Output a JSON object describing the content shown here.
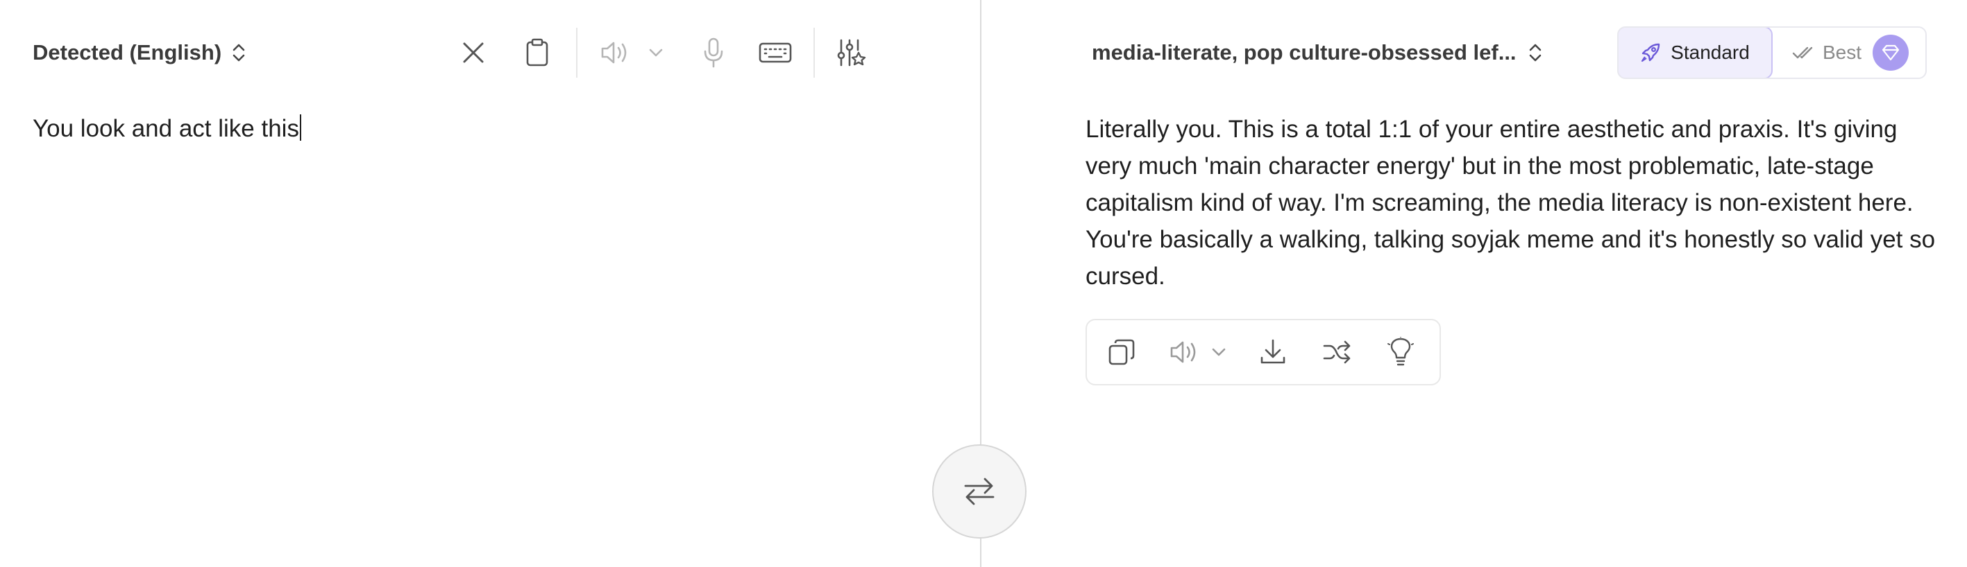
{
  "source": {
    "language_label": "Detected (English)",
    "text": "You look and act like this"
  },
  "target": {
    "language_label": "media-literate, pop culture-obsessed lef...",
    "text": "Literally you. This is a total 1:1 of your entire aesthetic and praxis. It's giving very much 'main character energy' but in the most problematic, late-stage capitalism kind of way. I'm screaming, the media literacy is non-existent here. You're basically a walking, talking soyjak meme and it's honestly so valid yet so cursed."
  },
  "mode": {
    "standard_label": "Standard",
    "best_label": "Best",
    "selected": "Standard"
  },
  "icons": {
    "source_toolbar": [
      "close-icon",
      "clipboard-icon",
      "speaker-icon",
      "chevron-down-icon",
      "microphone-icon",
      "keyboard-icon",
      "settings-sliders-icon"
    ],
    "output_toolbar": [
      "copy-icon",
      "speaker-icon",
      "chevron-down-icon",
      "download-icon",
      "shuffle-icon",
      "lightbulb-icon"
    ],
    "swap": "swap-arrows-icon",
    "standard": "rocket-icon",
    "best": "double-check-icon",
    "premium": "gem-icon"
  },
  "colors": {
    "accent_purple": "#a99cf0",
    "standard_bg": "#f0eefc",
    "icon_gray": "#6b6b6b",
    "icon_disabled": "#b5b5b5",
    "divider": "#dadada"
  }
}
